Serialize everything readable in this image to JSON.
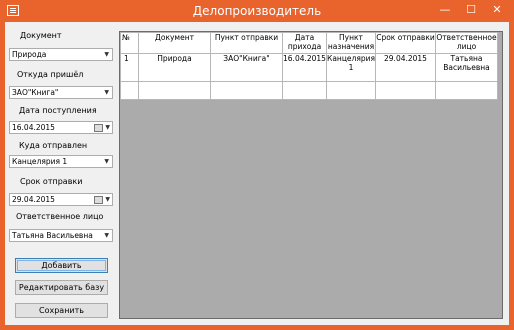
{
  "window": {
    "title": "Делопроизводитель",
    "minimize": "—",
    "maximize": "☐",
    "close": "✕"
  },
  "form": {
    "document_label": "Документ",
    "document_value": "Природа",
    "from_label": "Откуда пришёл",
    "from_value": "ЗАО\"Книга\"",
    "received_label": "Дата поступления",
    "received_value": "16.04.2015",
    "to_label": "Куда отправлен",
    "to_value": "Канцелярия 1",
    "deadline_label": "Срок отправки",
    "deadline_value": "29.04.2015",
    "responsible_label": "Ответственное лицо",
    "responsible_value": "Татьяна Васильевна"
  },
  "buttons": {
    "add": "Добавить",
    "edit_db": "Редактировать базу",
    "save": "Сохранить"
  },
  "table": {
    "headers": [
      "№",
      "Документ",
      "Пункт отправки",
      "Дата прихода",
      "Пункт назначения",
      "Срок отправки",
      "Ответственное лицо"
    ],
    "rows": [
      [
        "1",
        "Природа",
        "ЗАО\"Книга\"",
        "16.04.2015",
        "Канцелярия 1",
        "29.04.2015",
        "Татьяна Васильевна"
      ]
    ]
  }
}
